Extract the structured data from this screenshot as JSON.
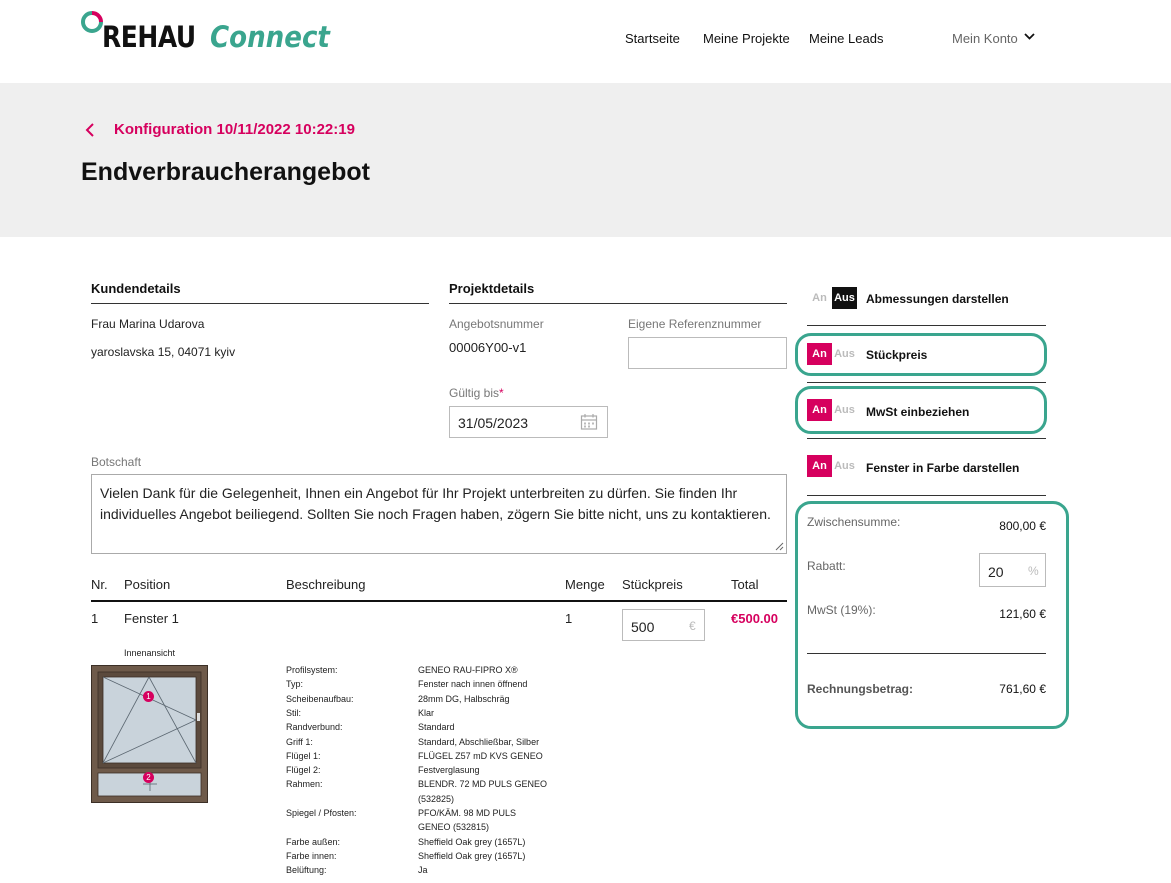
{
  "header": {
    "logo_rehau": "REHAU",
    "logo_connect": "Connect",
    "nav": [
      "Startseite",
      "Meine Projekte",
      "Meine Leads"
    ],
    "account": "Mein Konto"
  },
  "band": {
    "breadcrumb": "Konfiguration 10/11/2022 10:22:19",
    "title": "Endverbraucherangebot"
  },
  "customer": {
    "title": "Kundendetails",
    "name": "Frau Marina Udarova",
    "address": "yaroslavska 15, 04071 kyiv"
  },
  "project": {
    "title": "Projektdetails",
    "offer_label": "Angebotsnummer",
    "offer_value": "00006Y00-v1",
    "ref_label": "Eigene Referenznummer",
    "ref_value": "",
    "valid_label": "Gültig bis",
    "valid_required": "*",
    "valid_value": "31/05/2023"
  },
  "message": {
    "label": "Botschaft",
    "text": "Vielen Dank für die Gelegenheit, Ihnen ein Angebot für Ihr Projekt unterbreiten zu dürfen. Sie finden Ihr individuelles Angebot beiliegend. Sollten Sie noch Fragen haben, zögern Sie bitte nicht, uns zu kontaktieren."
  },
  "table": {
    "headers": [
      "Nr.",
      "Position",
      "Beschreibung",
      "Menge",
      "Stückpreis",
      "Total"
    ],
    "row": {
      "nr": "1",
      "position": "Fenster 1",
      "menge": "1",
      "price": "500",
      "currency": "€",
      "total": "€500.00",
      "view_label": "Innenansicht",
      "markers": [
        "1",
        "2"
      ]
    },
    "specs": [
      {
        "label": "Profilsystem:",
        "value": "GENEO RAU-FIPRO X®"
      },
      {
        "label": "Typ:",
        "value": "Fenster nach innen öffnend"
      },
      {
        "label": "Scheibenaufbau:",
        "value": "28mm DG, Halbschräg"
      },
      {
        "label": "Stil:",
        "value": "Klar"
      },
      {
        "label": "Randverbund:",
        "value": "Standard"
      },
      {
        "label": "Griff 1:",
        "value": "Standard, Abschließbar, Silber"
      },
      {
        "label": "Flügel 1:",
        "value": "FLÜGEL Z57 mD KVS GENEO"
      },
      {
        "label": "Flügel 2:",
        "value": "Festverglasung"
      },
      {
        "label": "Rahmen:",
        "value": "BLENDR. 72 MD PULS GENEO"
      },
      {
        "label": "",
        "value": "(532825)"
      },
      {
        "label": "Spiegel / Pfosten:",
        "value": "PFO/KÄM. 98 MD PULS"
      },
      {
        "label": "",
        "value": "GENEO (532815)"
      },
      {
        "label": "Farbe außen:",
        "value": "Sheffield Oak grey (1657L)"
      },
      {
        "label": "Farbe innen:",
        "value": "Sheffield Oak grey (1657L)"
      },
      {
        "label": "Belüftung:",
        "value": "Ja"
      }
    ]
  },
  "toggles": {
    "on_label": "An",
    "off_label": "Aus",
    "items": [
      {
        "label": "Abmessungen darstellen",
        "state": "Aus"
      },
      {
        "label": "Stückpreis",
        "state": "An"
      },
      {
        "label": "MwSt einbeziehen",
        "state": "An"
      },
      {
        "label": "Fenster in Farbe darstellen",
        "state": "An"
      }
    ]
  },
  "summary": {
    "subtotal_label": "Zwischensumme:",
    "subtotal_value": "800,00 €",
    "discount_label": "Rabatt:",
    "discount_value": "20",
    "discount_unit": "%",
    "vat_label": "MwSt (19%):",
    "vat_value": "121,60 €",
    "invoice_label": "Rechnungsbetrag:",
    "invoice_value": "761,60 €"
  },
  "colors": {
    "brand_pink": "#d6005e",
    "brand_green": "#3aa58e",
    "band_grey": "#efefef"
  }
}
